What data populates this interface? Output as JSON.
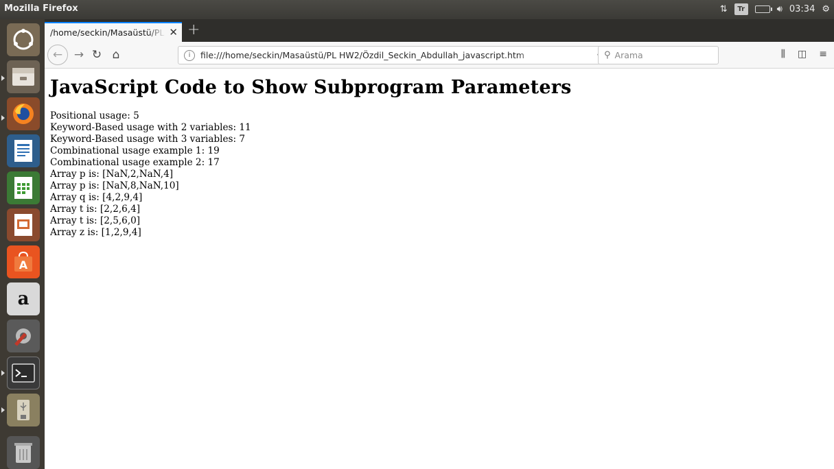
{
  "top_panel": {
    "title": "Mozilla Firefox",
    "keyboard_layout": "Tr",
    "time": "03:34"
  },
  "browser": {
    "tab_title": "/home/seckin/Masaüstü/PL",
    "url": "file:///home/seckin/Masaüstü/PL HW2/Özdil_Seckin_Abdullah_javascript.htm",
    "search_placeholder": "Arama"
  },
  "page": {
    "heading": "JavaScript Code to Show Subprogram Parameters",
    "lines": [
      "Positional usage: 5",
      "Keyword-Based usage with 2 variables: 11",
      "Keyword-Based usage with 3 variables: 7",
      "Combinational usage example 1: 19",
      "Combinational usage example 2: 17",
      "Array p is: [NaN,2,NaN,4]",
      "Array p is: [NaN,8,NaN,10]",
      "Array q is: [4,2,9,4]",
      "Array t is: [2,2,6,4]",
      "Array t is: [2,5,6,0]",
      "Array z is: [1,2,9,4]"
    ]
  },
  "launcher": {
    "items": [
      "ubuntu-dash",
      "files",
      "firefox",
      "libreoffice-writer",
      "libreoffice-calc",
      "libreoffice-impress",
      "ubuntu-software",
      "amazon",
      "system-settings",
      "terminal",
      "usb-drive",
      "trash"
    ],
    "amazon_glyph": "a"
  },
  "colors": {
    "panel": "#3b3a36",
    "launcher": "#3e3a33",
    "tab_accent": "#0a84ff"
  }
}
